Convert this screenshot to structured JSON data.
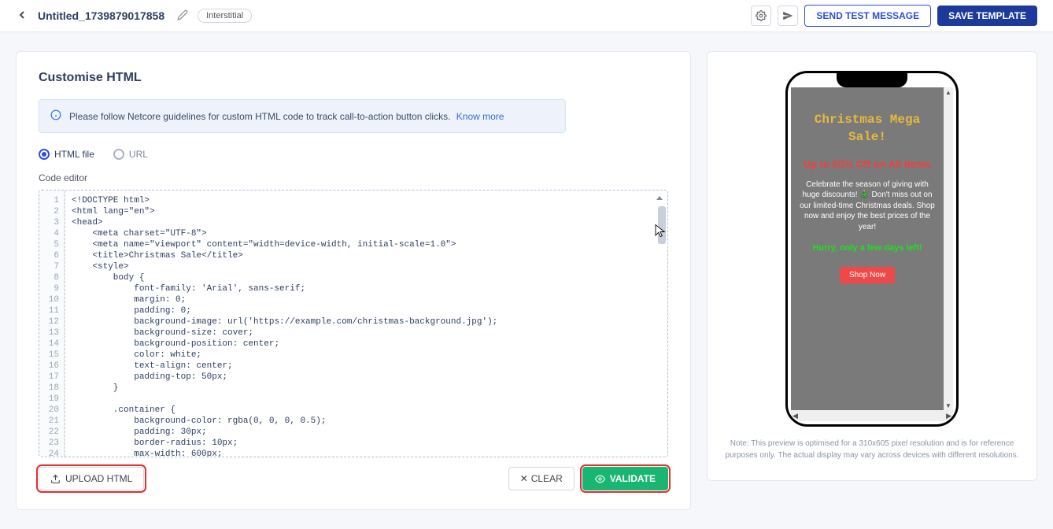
{
  "header": {
    "title": "Untitled_1739879017858",
    "badge": "Interstitial",
    "send_test": "SEND TEST MESSAGE",
    "save_template": "SAVE TEMPLATE"
  },
  "editor": {
    "panel_title": "Customise HTML",
    "info_text": "Please follow Netcore guidelines for custom HTML code to track call-to-action button clicks.",
    "info_link": "Know more",
    "radio_html": "HTML file",
    "radio_url": "URL",
    "editor_label": "Code editor",
    "line_numbers": [
      "1",
      "2",
      "3",
      "4",
      "5",
      "6",
      "7",
      "8",
      "9",
      "10",
      "11",
      "12",
      "13",
      "14",
      "15",
      "16",
      "17",
      "18",
      "19",
      "20",
      "21",
      "22",
      "23",
      "24"
    ],
    "code": "<!DOCTYPE html>\n<html lang=\"en\">\n<head>\n    <meta charset=\"UTF-8\">\n    <meta name=\"viewport\" content=\"width=device-width, initial-scale=1.0\">\n    <title>Christmas Sale</title>\n    <style>\n        body {\n            font-family: 'Arial', sans-serif;\n            margin: 0;\n            padding: 0;\n            background-image: url('https://example.com/christmas-background.jpg');\n            background-size: cover;\n            background-position: center;\n            color: white;\n            text-align: center;\n            padding-top: 50px;\n        }\n\n        .container {\n            background-color: rgba(0, 0, 0, 0.5);\n            padding: 30px;\n            border-radius: 10px;\n            max-width: 600px;",
    "upload": "UPLOAD HTML",
    "clear": "CLEAR",
    "validate": "VALIDATE"
  },
  "preview": {
    "h1": "Christmas Mega Sale!",
    "sub": "Up to 50% Off on All Items",
    "body": "Celebrate the season of giving with huge discounts! 🎄 Don't miss out on our limited-time Christmas deals. Shop now and enjoy the best prices of the year!",
    "hurry": "Hurry, only a few days left!",
    "cta": "Shop Now",
    "note": "Note: This preview is optimised for a 310x605 pixel resolution and is for reference purposes only. The actual display may vary across devices with different resolutions."
  }
}
